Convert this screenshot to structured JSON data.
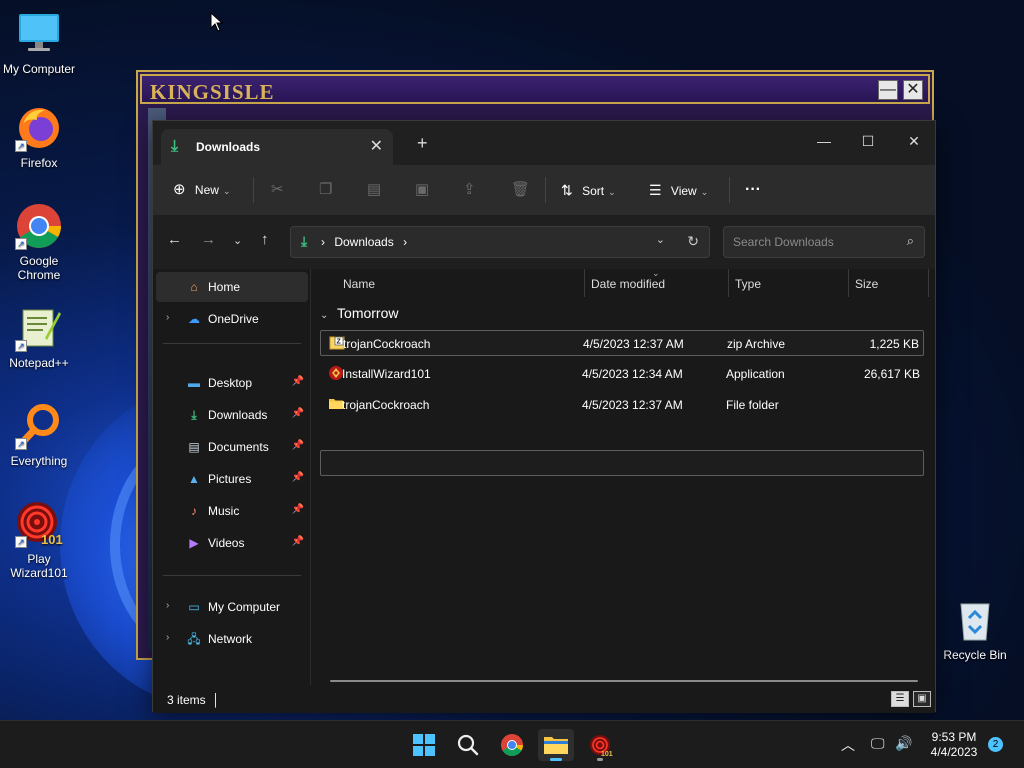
{
  "desktop": {
    "icons": [
      {
        "label": "My Computer",
        "icon": "monitor-icon"
      },
      {
        "label": "Firefox",
        "icon": "firefox-icon"
      },
      {
        "label": "Google Chrome",
        "icon": "chrome-icon"
      },
      {
        "label": "Notepad++",
        "icon": "notepadpp-icon"
      },
      {
        "label": "Everything",
        "icon": "search-magnifier-icon"
      },
      {
        "label": "Play Wizard101",
        "icon": "wizard101-icon"
      }
    ],
    "recycle_bin": {
      "label": "Recycle Bin",
      "icon": "recycle-bin-icon"
    }
  },
  "launcher": {
    "logo_text": "KINGSISLE",
    "minimize": "—",
    "close": "✕"
  },
  "explorer": {
    "tab": {
      "title": "Downloads",
      "close": "✕",
      "new_tab": "+"
    },
    "window_controls": {
      "minimize": "—",
      "maximize": "☐",
      "close": "✕"
    },
    "toolbar": {
      "new_label": "New",
      "sort_label": "Sort",
      "view_label": "View",
      "more_label": "···"
    },
    "address": {
      "path": "Downloads",
      "separator": "›"
    },
    "search": {
      "placeholder": "Search Downloads"
    },
    "sidebar": {
      "home": "Home",
      "onedrive": "OneDrive",
      "quick_access": [
        {
          "label": "Desktop",
          "icon": "desktop-icon"
        },
        {
          "label": "Downloads",
          "icon": "download-icon"
        },
        {
          "label": "Documents",
          "icon": "documents-icon"
        },
        {
          "label": "Pictures",
          "icon": "pictures-icon"
        },
        {
          "label": "Music",
          "icon": "music-icon"
        },
        {
          "label": "Videos",
          "icon": "videos-icon"
        }
      ],
      "my_computer": "My Computer",
      "network": "Network"
    },
    "columns": {
      "name": "Name",
      "date": "Date modified",
      "type": "Type",
      "size": "Size"
    },
    "group_label": "Tomorrow",
    "files": [
      {
        "name": "trojanCockroach",
        "date": "4/5/2023 12:37 AM",
        "type": "zip Archive",
        "size": "1,225 KB",
        "icon": "zip-icon"
      },
      {
        "name": "InstallWizard101",
        "date": "4/5/2023 12:34 AM",
        "type": "Application",
        "size": "26,617 KB",
        "icon": "installer-icon"
      },
      {
        "name": "trojanCockroach",
        "date": "4/5/2023 12:37 AM",
        "type": "File folder",
        "size": "",
        "icon": "folder-icon"
      }
    ],
    "status": "3 items"
  },
  "taskbar": {
    "time": "9:53 PM",
    "date": "4/4/2023",
    "notification_count": "2"
  },
  "colors": {
    "accent": "#4cc2ff",
    "download_green": "#3fbf7f",
    "kingsisle_gold": "#c9a84c",
    "kingsisle_purple": "#2b1a4e"
  }
}
